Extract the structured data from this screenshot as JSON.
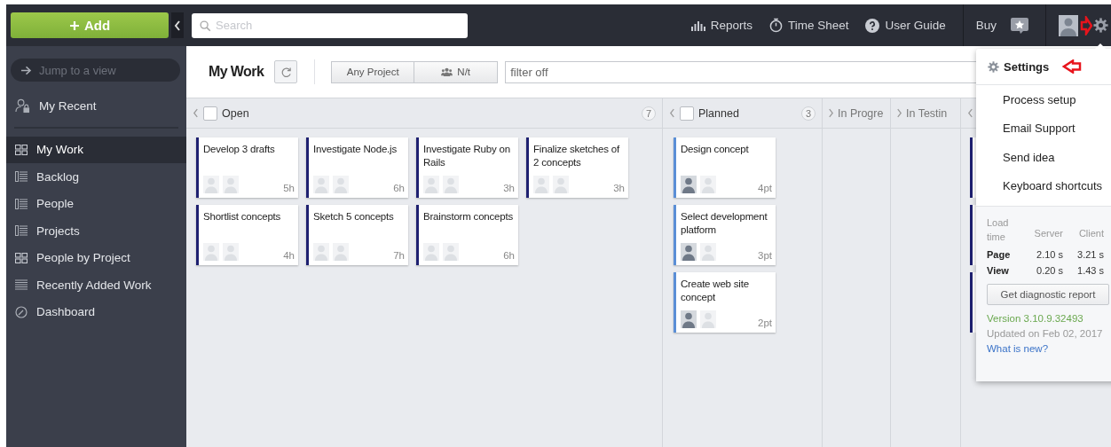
{
  "topbar": {
    "add_button": "Add",
    "search": {
      "placeholder": "Search"
    },
    "links": [
      {
        "label": "Reports",
        "kind": "reports"
      },
      {
        "label": "Time Sheet",
        "kind": "timer"
      },
      {
        "label": "User Guide",
        "kind": "help"
      }
    ],
    "buy": "Buy"
  },
  "sidebar": {
    "jump": {
      "placeholder": "Jump to a view"
    },
    "recent": "My Recent",
    "items": [
      {
        "label": "My Work",
        "kind": "board",
        "selected": true
      },
      {
        "label": "Backlog",
        "kind": "list",
        "selected": false
      },
      {
        "label": "People",
        "kind": "list",
        "selected": false
      },
      {
        "label": "Projects",
        "kind": "list",
        "selected": false
      },
      {
        "label": "People by Project",
        "kind": "board",
        "selected": false
      },
      {
        "label": "Recently Added Work",
        "kind": "lines",
        "selected": false
      },
      {
        "label": "Dashboard",
        "kind": "gauge",
        "selected": false
      }
    ]
  },
  "view": {
    "title": "My Work",
    "segments": [
      "Any Project",
      "N/t"
    ],
    "filter": {
      "value": "filter off"
    }
  },
  "columns": [
    {
      "title": "Open",
      "count": "7",
      "collapsed": false,
      "checked": false,
      "color": "#1e2070",
      "cards": [
        {
          "title": "Develop 3 drafts",
          "estimate": "5h",
          "avatars": [
            {
              "assigned": false
            },
            {
              "assigned": false
            }
          ]
        },
        {
          "title": "Investigate Node.js",
          "estimate": "6h",
          "avatars": [
            {
              "assigned": false
            },
            {
              "assigned": false
            }
          ]
        },
        {
          "title": "Investigate Ruby on Rails",
          "estimate": "3h",
          "avatars": [
            {
              "assigned": false
            },
            {
              "assigned": false
            }
          ]
        },
        {
          "title": "Finalize sketches of 2 concepts",
          "estimate": "3h",
          "avatars": [
            {
              "assigned": false
            },
            {
              "assigned": false
            }
          ]
        },
        {
          "title": "Shortlist concepts",
          "estimate": "4h",
          "avatars": [
            {
              "assigned": false
            },
            {
              "assigned": false
            }
          ]
        },
        {
          "title": "Sketch 5 concepts",
          "estimate": "7h",
          "avatars": [
            {
              "assigned": false
            },
            {
              "assigned": false
            }
          ]
        },
        {
          "title": "Brainstorm concepts",
          "estimate": "6h",
          "avatars": [
            {
              "assigned": false
            },
            {
              "assigned": false
            }
          ]
        }
      ]
    },
    {
      "title": "Planned",
      "count": "3",
      "collapsed": false,
      "checked": false,
      "color": "#5b8fd6",
      "cards": [
        {
          "title": "Design concept",
          "estimate": "4pt",
          "avatars": [
            {
              "assigned": true
            },
            {
              "assigned": false
            }
          ]
        },
        {
          "title": "Select development platform",
          "estimate": "3pt",
          "avatars": [
            {
              "assigned": true
            },
            {
              "assigned": false
            }
          ]
        },
        {
          "title": "Create web site concept",
          "estimate": "2pt",
          "avatars": [
            {
              "assigned": true
            },
            {
              "assigned": false
            }
          ]
        }
      ]
    },
    {
      "title": "In Progre",
      "collapsed": true
    },
    {
      "title": "In Testin",
      "collapsed": true
    }
  ],
  "menu": {
    "title": "Settings",
    "items": [
      "Process setup",
      "Email Support",
      "Send idea",
      "Keyboard shortcuts"
    ],
    "load_table": {
      "columns": [
        "Load time",
        "Server",
        "Client"
      ],
      "rows": [
        [
          "Page",
          "2.10 s",
          "3.21 s"
        ],
        [
          "View",
          "0.20 s",
          "1.43 s"
        ]
      ]
    },
    "report_button": "Get diagnostic report",
    "version": "Version 3.10.9.32493",
    "updated": "Updated on Feb 02, 2017",
    "whats_new": "What is new?"
  }
}
